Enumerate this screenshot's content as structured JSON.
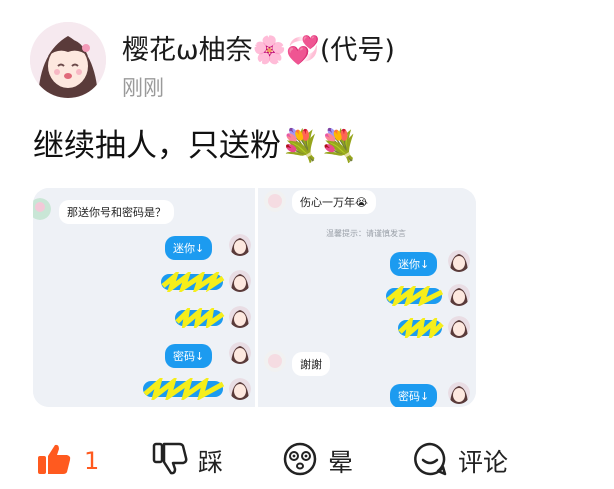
{
  "post": {
    "username": "樱花ω柚奈🌸💞(代号)",
    "time": "刚刚",
    "text": "继续抽人，只送粉💐💐"
  },
  "screenshot": {
    "left_panel": {
      "first_message": "那送你号和密码是？",
      "sent_1": "迷你↓",
      "sent_4": "密码↓"
    },
    "right_panel": {
      "first_message": "伤心一万年😭",
      "notice": "温馨提示：请谨慎发言",
      "sent_1": "迷你↓",
      "reply": "謝謝",
      "sent_4": "密码↓"
    }
  },
  "actions": {
    "like_count": "1",
    "dislike_label": "踩",
    "dizzy_label": "晕",
    "comment_label": "评论"
  },
  "colors": {
    "like": "#ff5a1f",
    "bubble": "#1c9bf0",
    "scribble": "#f5ee1a"
  }
}
